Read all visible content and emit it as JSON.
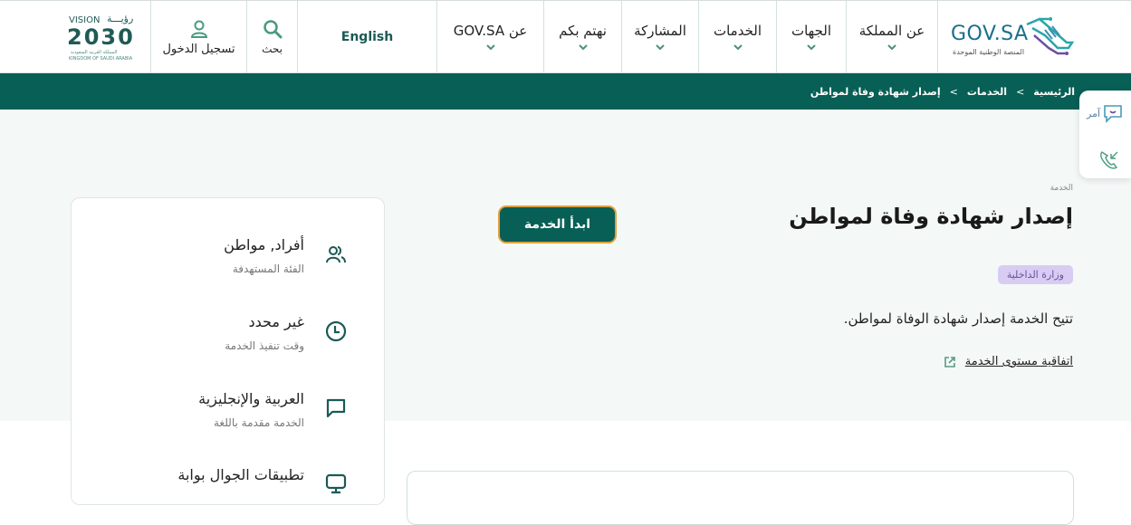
{
  "header": {
    "logo": {
      "title": "GOV.SA",
      "subtitle": "المنصة الوطنية الموحدة"
    },
    "nav": [
      {
        "label": "عن المملكة"
      },
      {
        "label": "الجهات"
      },
      {
        "label": "الخدمات"
      },
      {
        "label": "المشاركة"
      },
      {
        "label": "نهتم بكم"
      },
      {
        "label": "عن GOV.SA"
      }
    ],
    "language_label": "English",
    "search_label": "بحث",
    "login_label": "تسجيل الدخول",
    "vision": {
      "word": "VISION",
      "arabic": "رؤيـــة",
      "year": "2030",
      "line1": "المملكة العربية السعودية",
      "line2": "KINGDOM OF SAUDI ARABIA"
    }
  },
  "breadcrumb": {
    "items": [
      "الرئيسية",
      "الخدمات",
      "إصدار شهادة وفاة لمواطن"
    ],
    "separator": ">"
  },
  "floating": {
    "amer_label": "آمر"
  },
  "service": {
    "kicker": "الخدمة",
    "title": "إصدار شهادة وفاة لمواطن",
    "agency": "وزارة الداخلية",
    "description": "تتيح الخدمة إصدار شهادة الوفاة لمواطن.",
    "sla_link": "اتفاقية مستوى الخدمة",
    "start_button": "ابدأ الخدمة"
  },
  "info": [
    {
      "value": "أفراد, مواطن",
      "label": "الفئة المستهدفة",
      "icon": "users-icon"
    },
    {
      "value": "غير محدد",
      "label": "وقت تنفيذ الخدمة",
      "icon": "clock-icon"
    },
    {
      "value": "العربية والإنجليزية",
      "label": "الخدمة مقدمة باللغة",
      "icon": "chat-icon"
    },
    {
      "value": "تطبيقات الجوال بوابة",
      "label": "",
      "icon": "monitor-icon"
    }
  ],
  "colors": {
    "primary": "#075f55",
    "accent": "#e0a040",
    "badge_bg": "#d9ccf2",
    "badge_text": "#6a4fa0"
  }
}
